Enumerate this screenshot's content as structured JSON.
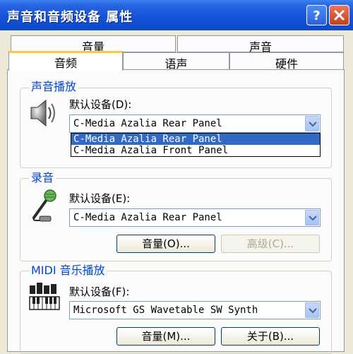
{
  "window": {
    "title": "声音和音频设备 属性"
  },
  "titlebar_buttons": {
    "help": "?",
    "close": "x"
  },
  "tabs_back": [
    "音量",
    "声音"
  ],
  "tabs_front": [
    "音频",
    "语声",
    "硬件"
  ],
  "playback": {
    "group_label": "声音播放",
    "default_label": "默认设备(D):",
    "selected": "C-Media Azalia Rear Panel",
    "options": [
      "C-Media Azalia Rear Panel",
      "C-Media Azalia Front Panel"
    ]
  },
  "recording": {
    "group_label": "录音",
    "default_label": "默认设备(E):",
    "selected": "C-Media Azalia Rear Panel",
    "volume_button": "音量(O)...",
    "advanced_button": "高级(C)..."
  },
  "midi": {
    "group_label": "MIDI 音乐播放",
    "default_label": "默认设备(F):",
    "selected": "Microsoft GS Wavetable SW Synth",
    "volume_button": "音量(M)...",
    "about_button": "关于(B)..."
  },
  "icons": {
    "speaker": "speaker-icon",
    "microphone": "microphone-icon",
    "midi": "midi-keyboard-icon",
    "dropdown": "chevron-down-icon"
  }
}
